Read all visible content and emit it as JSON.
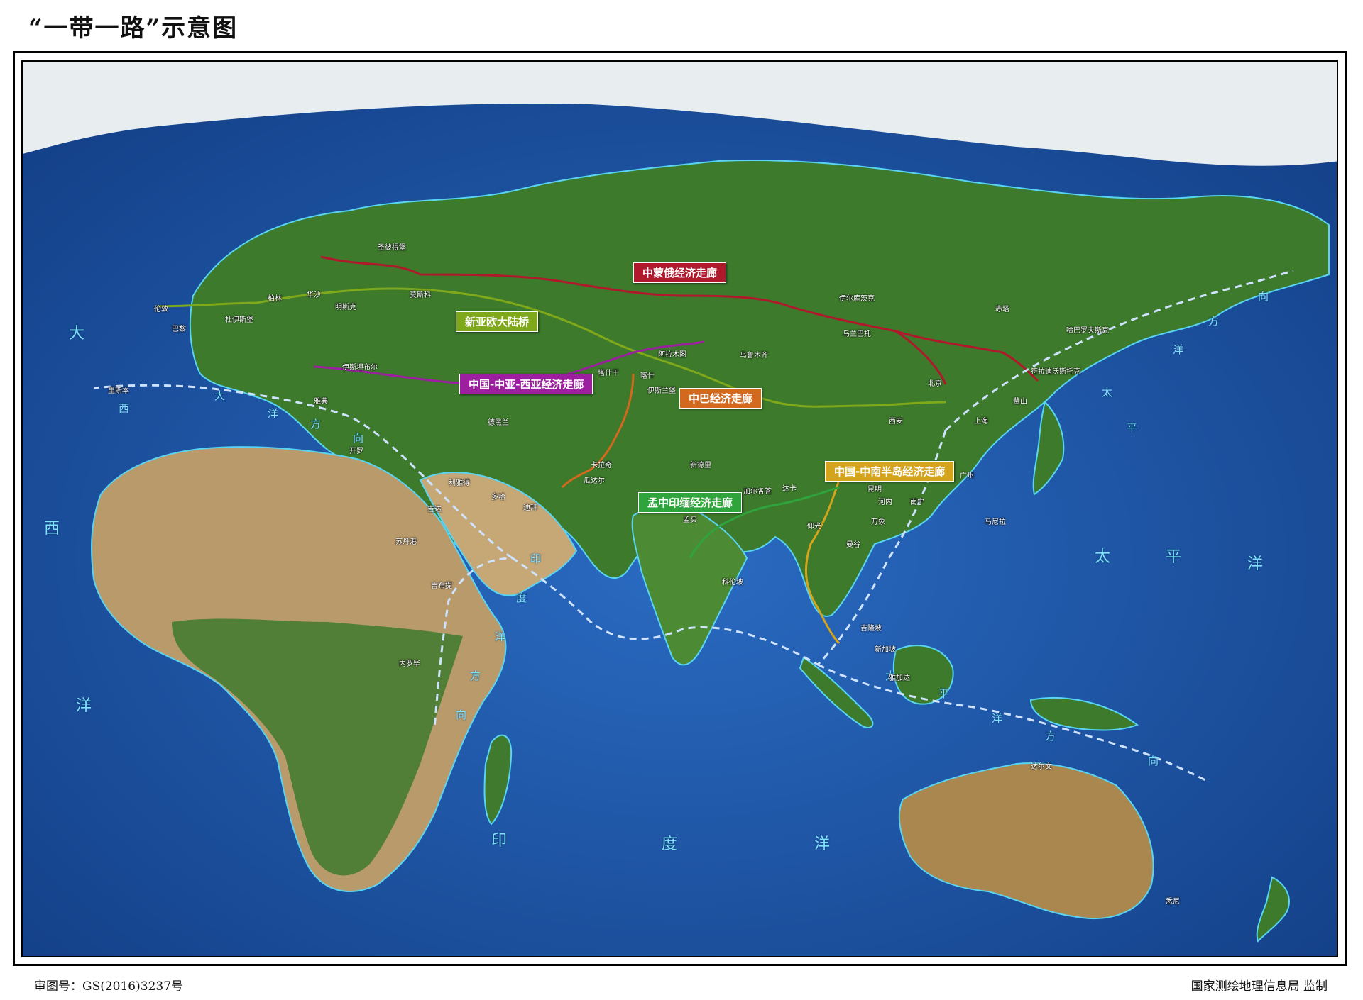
{
  "title": "“一带一路”示意图",
  "footer": {
    "approval_no": "审图号：GS(2016)3237号",
    "supervisor": "国家测绘地理信息局 监制"
  },
  "colors": {
    "ocean": "#1b4f9e",
    "land": "#3e7a2e",
    "desert": "#c8a97a",
    "ice": "#e9f0f2",
    "coast": "#59d4f2",
    "sea_route": "#cfe3ff"
  },
  "corridors": [
    {
      "id": "china-mongolia-russia",
      "label": "中蒙俄经济走廊",
      "color": "#b0182b"
    },
    {
      "id": "new-eurasian-land-bridge",
      "label": "新亚欧大陆桥",
      "color": "#7fa81a"
    },
    {
      "id": "china-central-west-asia",
      "label": "中国-中亚-西亚经济走廊",
      "color": "#9b1f9e"
    },
    {
      "id": "china-pakistan",
      "label": "中巴经济走廊",
      "color": "#d2691e"
    },
    {
      "id": "china-indochina",
      "label": "中国-中南半岛经济走廊",
      "color": "#d4a51c"
    },
    {
      "id": "bcim",
      "label": "孟中印缅经济走廊",
      "color": "#2fa33c"
    }
  ],
  "ocean_labels": {
    "atlantic": [
      "大",
      "西",
      "洋"
    ],
    "pacific": [
      "太",
      "平",
      "洋"
    ],
    "indian": [
      "印",
      "度",
      "洋"
    ]
  },
  "route_direction_labels": {
    "to_atlantic": [
      "大",
      "西",
      "洋",
      "方",
      "向"
    ],
    "to_indian": [
      "印",
      "度",
      "洋",
      "方",
      "向"
    ],
    "to_north_pacific": [
      "太",
      "平",
      "洋",
      "方",
      "向"
    ],
    "to_south_pacific": [
      "太",
      "平",
      "洋",
      "方",
      "向"
    ]
  },
  "cities": {
    "saint_petersburg": "圣彼得堡",
    "moscow": "莫斯科",
    "london": "伦敦",
    "rotterdam": "鹿特丹",
    "duisburg": "杜伊斯堡",
    "berlin": "柏林",
    "warsaw": "华沙",
    "minsk": "明斯克",
    "paris": "巴黎",
    "le_havre": "法兰克福",
    "lisbon": "里斯本",
    "athens": "雅典",
    "istanbul": "伊斯坦布尔",
    "ankara": "安卡拉",
    "tehran": "德黑兰",
    "cairo": "开罗",
    "djibouti": "吉布提",
    "nairobi": "内罗毕",
    "mombasa": "蒙巴萨",
    "riyadh": "利雅得",
    "doha": "多哈",
    "dubai": "迪拜",
    "jeddah": "吉达",
    "port_sudan": "苏丹港",
    "almaty": "阿拉木图",
    "tashkent": "塔什干",
    "kashgar": "喀什",
    "urumqi": "乌鲁木齐",
    "irkutsk": "伊尔库茨克",
    "ulan_bator": "乌兰巴托",
    "beijing": "北京",
    "xian": "西安",
    "shanghai": "上海",
    "dalian": "大连",
    "busan": "釜山",
    "vladivostok": "符拉迪沃斯托克",
    "khabarovsk": "哈巴罗夫斯克",
    "chita": "赤塔",
    "islamabad": "伊斯兰堡",
    "gwadar": "瓜达尔",
    "karachi": "卡拉奇",
    "new_delhi": "新德里",
    "kolkata": "加尔各答",
    "dhaka": "达卡",
    "mumbai": "孟买",
    "colombo": "科伦坡",
    "kunming": "昆明",
    "nanning": "南宁",
    "hanoi": "河内",
    "vientiane": "万象",
    "bangkok": "曼谷",
    "yangon": "仰光",
    "kuala_lumpur": "吉隆坡",
    "singapore": "新加坡",
    "jakarta": "雅加达",
    "manila": "马尼拉",
    "guangzhou": "广州",
    "darwin": "达尔文",
    "sydney": "悉尼"
  }
}
